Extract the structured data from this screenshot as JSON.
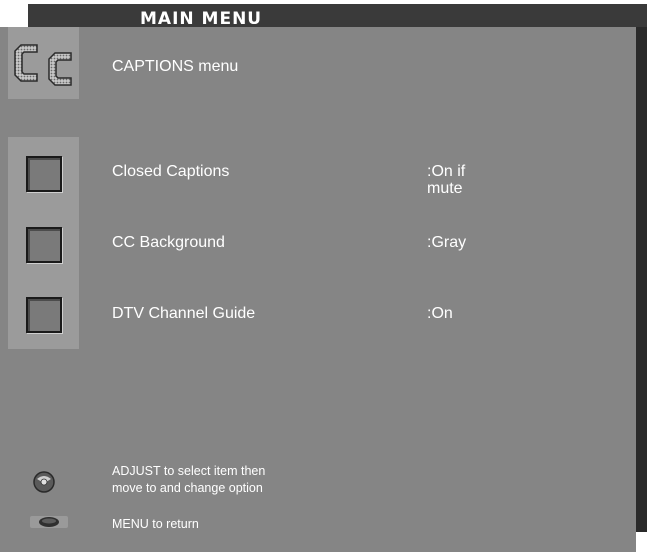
{
  "header": {
    "title": "MAIN MENU"
  },
  "menu": {
    "title": "CAPTIONS menu",
    "icon": "cc-icon",
    "items": [
      {
        "label": "Closed Captions",
        "value": ":On if\n mute",
        "icon": "checkbox-icon"
      },
      {
        "label": "CC Background",
        "value": ":Gray",
        "icon": "checkbox-icon"
      },
      {
        "label": "DTV Channel Guide",
        "value": ":On",
        "icon": "checkbox-icon"
      }
    ]
  },
  "help": {
    "adjust_text": "ADJUST to select item then\nmove to and change option",
    "adjust_icon": "joystick-icon",
    "menu_text": "MENU to return",
    "menu_icon": "menu-button-icon"
  },
  "colors": {
    "panel": "#858585",
    "icon_cell": "#9b9b9b",
    "title_bar": "#3a3a3a",
    "text": "#ffffff"
  }
}
